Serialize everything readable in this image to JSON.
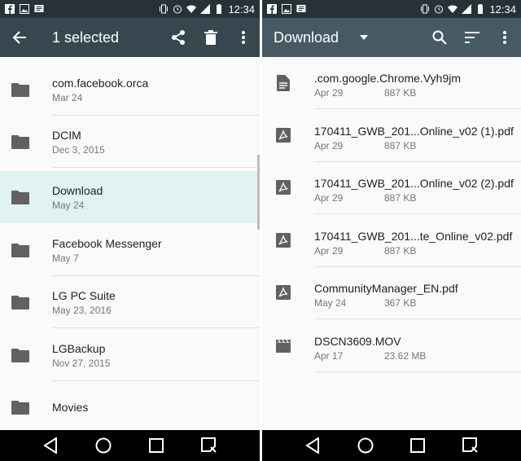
{
  "status_bar": {
    "time": "12:34"
  },
  "left": {
    "title": "1 selected",
    "folders": [
      {
        "name": "com.facebook.orca",
        "date": "Mar 24"
      },
      {
        "name": "DCIM",
        "date": "Dec 3, 2015"
      },
      {
        "name": "Download",
        "date": "May 24",
        "selected": true
      },
      {
        "name": "Facebook Messenger",
        "date": "May 7"
      },
      {
        "name": "LG PC Suite",
        "date": "May 23, 2016"
      },
      {
        "name": "LGBackup",
        "date": "Nov 27, 2015"
      },
      {
        "name": "Movies",
        "date": ""
      }
    ]
  },
  "right": {
    "title": "Download",
    "files": [
      {
        "name": ".com.google.Chrome.Vyh9jm",
        "date": "Apr 29",
        "size": "887 KB",
        "icon": "document-icon"
      },
      {
        "name": "170411_GWB_201...Online_v02 (1).pdf",
        "date": "Apr 29",
        "size": "887 KB",
        "icon": "pdf-icon"
      },
      {
        "name": "170411_GWB_201...Online_v02 (2).pdf",
        "date": "Apr 29",
        "size": "887 KB",
        "icon": "pdf-icon"
      },
      {
        "name": "170411_GWB_201...te_Online_v02.pdf",
        "date": "Apr 29",
        "size": "887 KB",
        "icon": "pdf-icon"
      },
      {
        "name": "CommunityManager_EN.pdf",
        "date": "May 24",
        "size": "367 KB",
        "icon": "pdf-icon"
      },
      {
        "name": "DSCN3609.MOV",
        "date": "Apr 17",
        "size": "23.62 MB",
        "icon": "video-icon"
      }
    ]
  },
  "colors": {
    "status_bar": "#263238",
    "left_toolbar": "#37474f",
    "right_toolbar": "#455a64",
    "selected_row": "#e0f2f1"
  }
}
